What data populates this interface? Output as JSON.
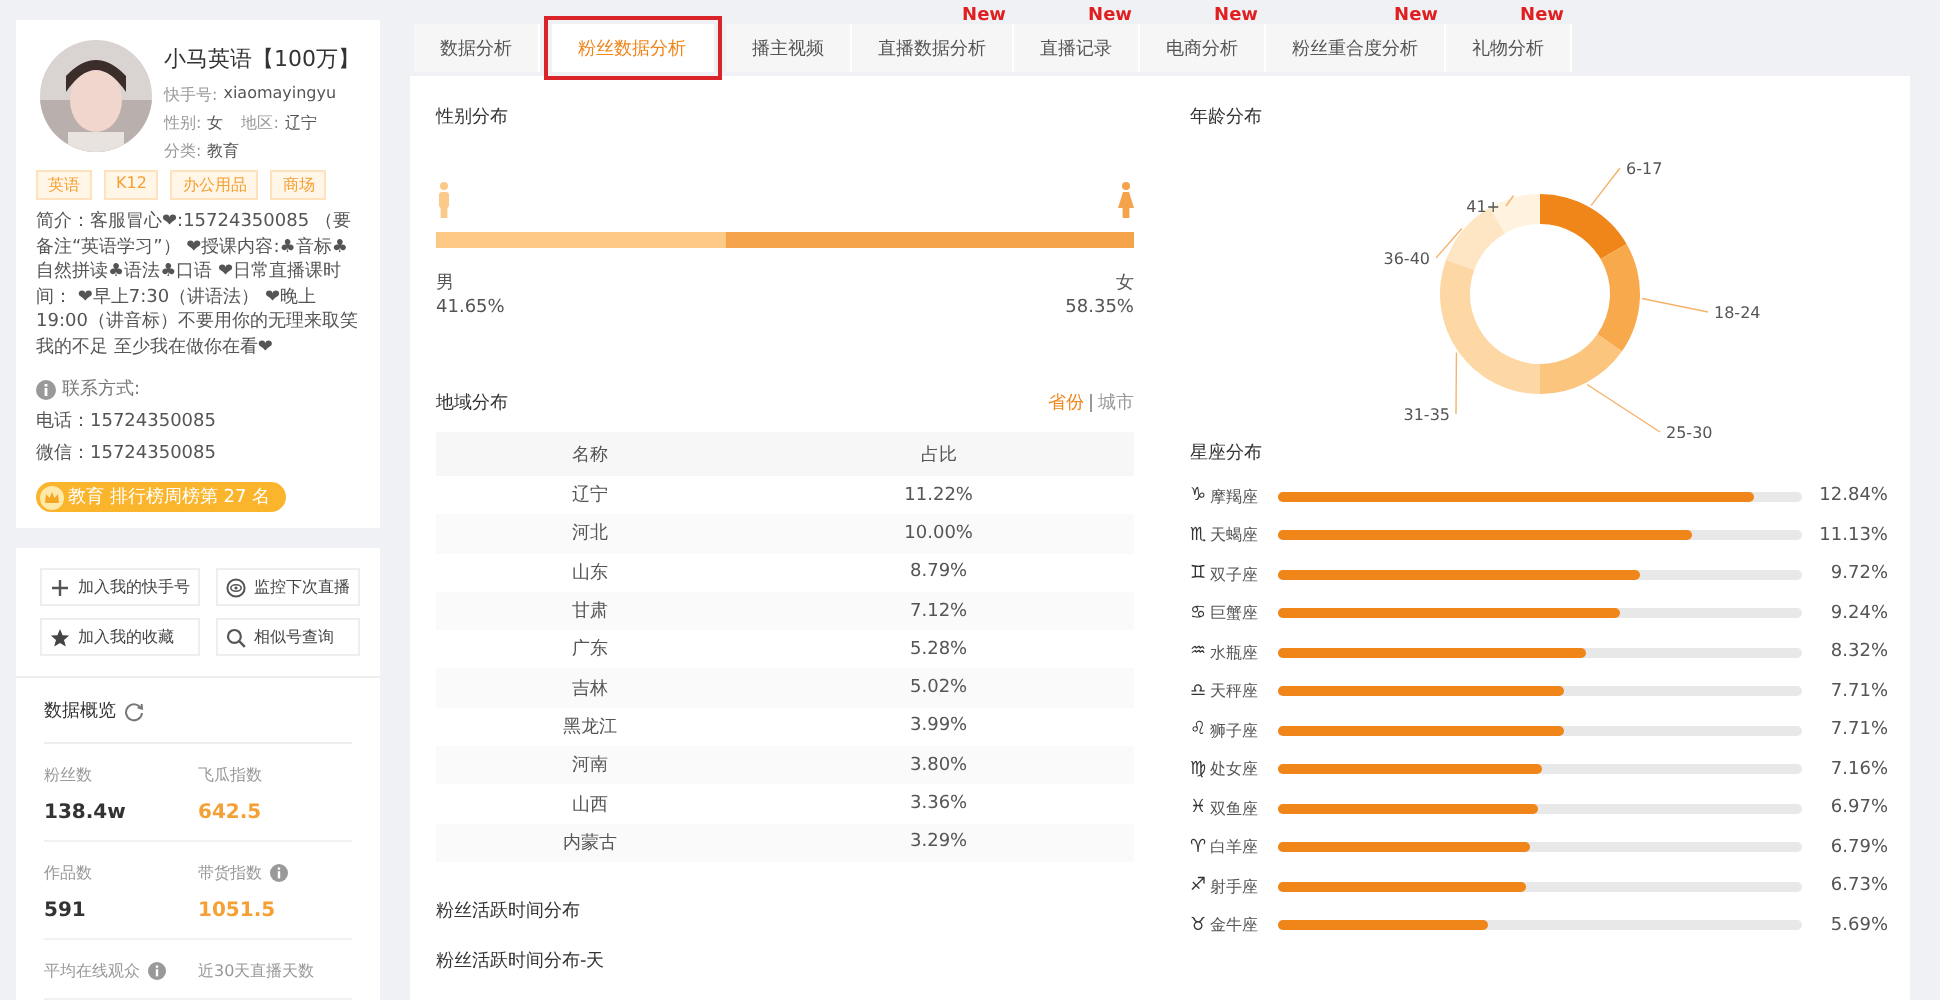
{
  "profile": {
    "name": "小马英语【100万】",
    "id_label": "快手号:",
    "id_value": "xiaomayingyu",
    "gender_label": "性别:",
    "gender_value": "女",
    "region_label": "地区:",
    "region_value": "辽宁",
    "category_label": "分类:",
    "category_value": "教育",
    "tags": [
      "英语",
      "K12",
      "办公用品",
      "商场"
    ],
    "intro": "简介：客服冒心❤:15724350085 （要备注“英语学习”） ❤授课内容:♣音标♣自然拼读♣语法♣口语 ❤日常直播课时间： ❤早上7:30（讲语法） ❤晚上19:00（讲音标）不要用你的无理来取笑我的不足 至少我在做你在看❤",
    "contact_title": "联系方式:",
    "phone": "电话：15724350085",
    "wechat": "微信：15724350085",
    "rank": "教育 排行榜周榜第 27 名"
  },
  "actions": [
    {
      "label": "加入我的快手号"
    },
    {
      "label": "监控下次直播"
    },
    {
      "label": "加入我的收藏"
    },
    {
      "label": "相似号查询"
    }
  ],
  "overview": {
    "title": "数据概览",
    "stats": [
      {
        "label": "粉丝数",
        "value": "138.4w",
        "highlight": false,
        "info": false
      },
      {
        "label": "飞瓜指数",
        "value": "642.5",
        "highlight": true,
        "info": false
      },
      {
        "label": "作品数",
        "value": "591",
        "highlight": false,
        "info": false
      },
      {
        "label": "带货指数",
        "value": "1051.5",
        "highlight": true,
        "info": true
      },
      {
        "label": "平均在线观众",
        "info": true
      },
      {
        "label": "近30天直播天数",
        "info": false
      }
    ]
  },
  "tabs": [
    {
      "label": "数据分析",
      "selected": false
    },
    {
      "label": "粉丝数据分析",
      "selected": true
    },
    {
      "label": "播主视频",
      "selected": false
    },
    {
      "label": "直播数据分析",
      "selected": false,
      "badge": "New"
    },
    {
      "label": "直播记录",
      "selected": false,
      "badge": "New"
    },
    {
      "label": "电商分析",
      "selected": false,
      "badge": "New"
    },
    {
      "label": "粉丝重合度分析",
      "selected": false,
      "badge": "New"
    },
    {
      "label": "礼物分析",
      "selected": false,
      "badge": "New"
    }
  ],
  "gender": {
    "title": "性别分布",
    "male_label": "男",
    "male_value": "41.65%",
    "female_label": "女",
    "female_value": "58.35%",
    "level": 0.4165
  },
  "region": {
    "title": "地域分布",
    "toggles": [
      {
        "label": "省份",
        "selected": true
      },
      {
        "label": "城市",
        "selected": false
      }
    ],
    "columns": [
      "名称",
      "占比"
    ],
    "rows": [
      [
        "辽宁",
        "11.22%"
      ],
      [
        "河北",
        "10.00%"
      ],
      [
        "山东",
        "8.79%"
      ],
      [
        "甘肃",
        "7.12%"
      ],
      [
        "广东",
        "5.28%"
      ],
      [
        "吉林",
        "5.02%"
      ],
      [
        "黑龙江",
        "3.99%"
      ],
      [
        "河南",
        "3.80%"
      ],
      [
        "山西",
        "3.36%"
      ],
      [
        "内蒙古",
        "3.29%"
      ]
    ]
  },
  "age": {
    "title": "年龄分布",
    "labels": [
      "6-17",
      "18-24",
      "25-30",
      "31-35",
      "36-40",
      "41+"
    ]
  },
  "zodiac": {
    "title": "星座分布",
    "rows": [
      {
        "symbol": "♑",
        "name": "摩羯座",
        "value": "12.84%",
        "level": 0.91
      },
      {
        "symbol": "♏",
        "name": "天蝎座",
        "value": "11.13%",
        "level": 0.79
      },
      {
        "symbol": "♊",
        "name": "双子座",
        "value": "9.72%",
        "level": 0.69
      },
      {
        "symbol": "♋",
        "name": "巨蟹座",
        "value": "9.24%",
        "level": 0.655
      },
      {
        "symbol": "♒",
        "name": "水瓶座",
        "value": "8.32%",
        "level": 0.59
      },
      {
        "symbol": "♎",
        "name": "天秤座",
        "value": "7.71%",
        "level": 0.545
      },
      {
        "symbol": "♌",
        "name": "狮子座",
        "value": "7.71%",
        "level": 0.545
      },
      {
        "symbol": "♍",
        "name": "处女座",
        "value": "7.16%",
        "level": 0.505
      },
      {
        "symbol": "♓",
        "name": "双鱼座",
        "value": "6.97%",
        "level": 0.495
      },
      {
        "symbol": "♈",
        "name": "白羊座",
        "value": "6.79%",
        "level": 0.48
      },
      {
        "symbol": "♐",
        "name": "射手座",
        "value": "6.73%",
        "level": 0.475
      },
      {
        "symbol": "♉",
        "name": "金牛座",
        "value": "5.69%",
        "level": 0.4
      }
    ]
  },
  "activity": {
    "title": "粉丝活跃时间分布",
    "subtitle": "粉丝活跃时间分布-天"
  }
}
